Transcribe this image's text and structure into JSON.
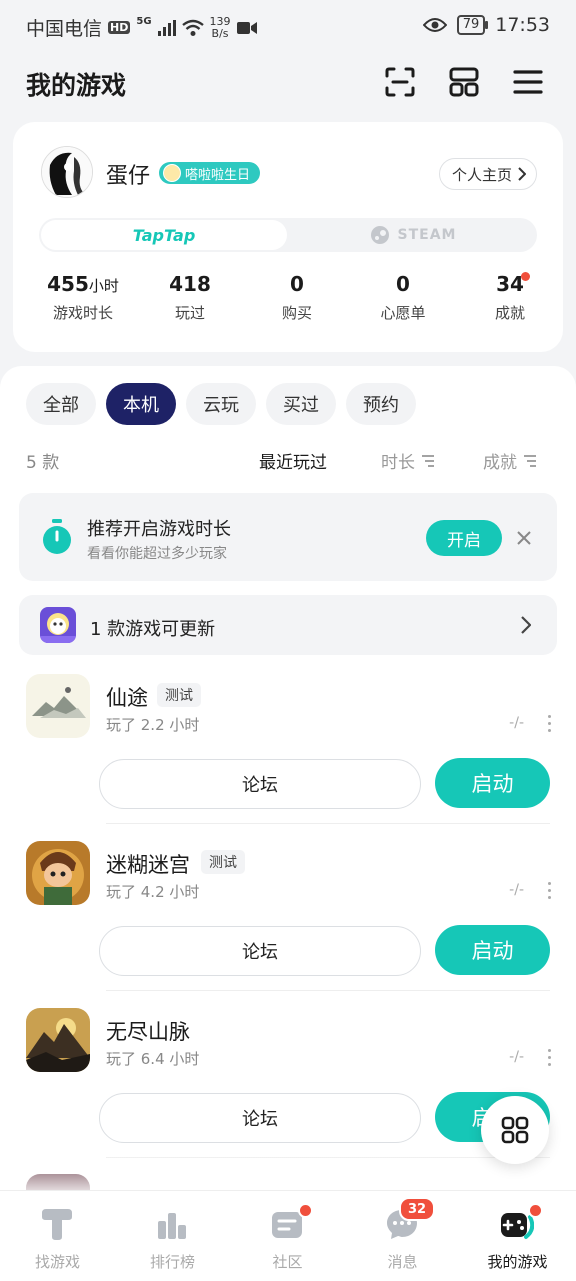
{
  "status_bar": {
    "carrier": "中国电信",
    "hd": "HD",
    "net": "5G",
    "speed_value": "139",
    "speed_unit": "B/s",
    "battery": "79",
    "time": "17:53"
  },
  "header": {
    "title": "我的游戏",
    "icons": [
      "scan-icon",
      "grid-apps-icon",
      "menu-icon"
    ]
  },
  "profile": {
    "username": "蛋仔",
    "badge": "嗒啦啦生日",
    "homepage_label": "个人主页",
    "platform_tabs": [
      {
        "label": "TapTap",
        "active": true
      },
      {
        "label": "STEAM",
        "active": false
      }
    ],
    "stats": [
      {
        "value": "455",
        "unit": "小时",
        "label": "游戏时长",
        "dot": false
      },
      {
        "value": "418",
        "unit": "",
        "label": "玩过",
        "dot": false
      },
      {
        "value": "0",
        "unit": "",
        "label": "购买",
        "dot": false
      },
      {
        "value": "0",
        "unit": "",
        "label": "心愿单",
        "dot": false
      },
      {
        "value": "34",
        "unit": "",
        "label": "成就",
        "dot": true
      }
    ]
  },
  "filters": {
    "chips": [
      "全部",
      "本机",
      "云玩",
      "买过",
      "预约"
    ],
    "active": "本机"
  },
  "sort": {
    "count": "5 款",
    "options": [
      "最近玩过",
      "时长",
      "成就"
    ],
    "active": "最近玩过"
  },
  "banner": {
    "title": "推荐开启游戏时长",
    "subtitle": "看看你能超过多少玩家",
    "button": "开启"
  },
  "update_row": {
    "text": "1 款游戏可更新"
  },
  "games": [
    {
      "name": "仙途",
      "tag": "测试",
      "played": "玩了 2.2 小时",
      "score": "-/-",
      "forum": "论坛",
      "launch": "启动"
    },
    {
      "name": "迷糊迷宫",
      "tag": "测试",
      "played": "玩了 4.2 小时",
      "score": "-/-",
      "forum": "论坛",
      "launch": "启动"
    },
    {
      "name": "无尽山脉",
      "tag": "",
      "played": "玩了 6.4 小时",
      "score": "-/-",
      "forum": "论坛",
      "launch": "启动"
    }
  ],
  "bottom_nav": [
    {
      "label": "找游戏",
      "badge": "",
      "active": false
    },
    {
      "label": "排行榜",
      "badge": "",
      "active": false
    },
    {
      "label": "社区",
      "badge": "dot",
      "active": false
    },
    {
      "label": "消息",
      "badge": "32",
      "active": false
    },
    {
      "label": "我的游戏",
      "badge": "dot",
      "active": true
    }
  ],
  "colors": {
    "accent": "#16c7b7",
    "active_chip": "#1e2266",
    "alert": "#f04f3c"
  }
}
